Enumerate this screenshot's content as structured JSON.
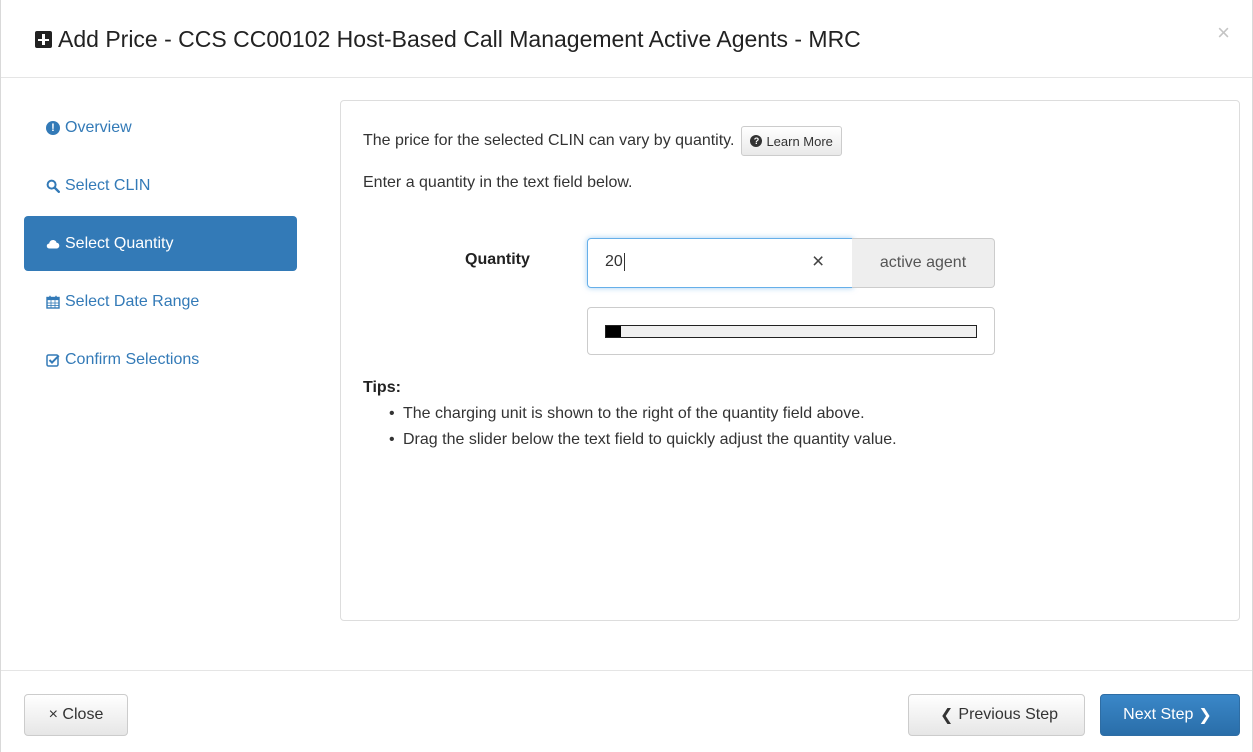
{
  "dialog": {
    "title": "Add Price - CCS CC00102 Host-Based Call Management Active Agents - MRC",
    "close_symbol": "×",
    "icons": {
      "title": "plus-square-icon",
      "close": "close-icon"
    }
  },
  "sidebar": {
    "items": [
      {
        "label": "Overview",
        "icon": "info-circle-icon",
        "active": false
      },
      {
        "label": "Select CLIN",
        "icon": "search-icon",
        "active": false
      },
      {
        "label": "Select Quantity",
        "icon": "cloud-icon",
        "active": true
      },
      {
        "label": "Select Date Range",
        "icon": "calendar-icon",
        "active": false
      },
      {
        "label": "Confirm Selections",
        "icon": "check-square-icon",
        "active": false
      }
    ],
    "active_color": "#337ab7"
  },
  "main": {
    "intro_text": "The price for the selected CLIN can vary by quantity.",
    "learn_more_label": "Learn More",
    "enter_text": "Enter a quantity in the text field below.",
    "quantity_label": "Quantity",
    "quantity_value": "20",
    "clear_symbol": "×",
    "unit": "active agent",
    "slider_fraction": 0.04,
    "tips_title": "Tips:",
    "tips": [
      "The charging unit is shown to the right of the quantity field above.",
      "Drag the slider below the text field to quickly adjust the quantity value."
    ]
  },
  "footer": {
    "close_label": "× Close",
    "prev_label": "Previous Step",
    "next_label": "Next Step",
    "next_color": "#337ab7"
  }
}
